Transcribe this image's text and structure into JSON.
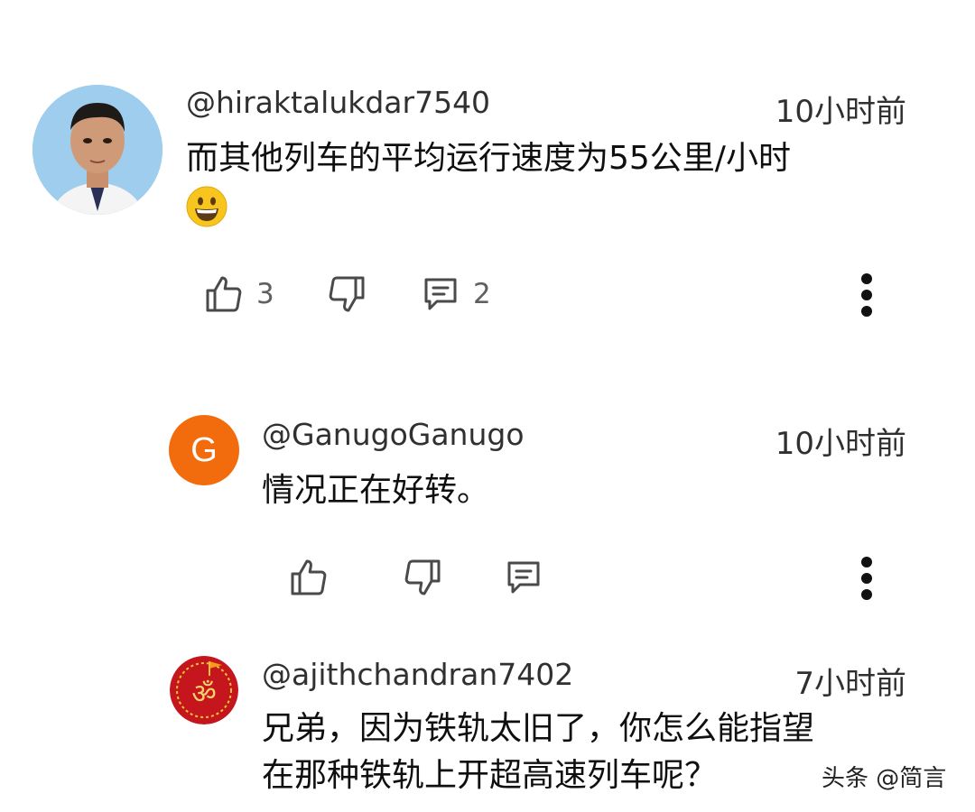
{
  "comments": [
    {
      "handle": "@hiraktalukdar7540",
      "time": "10小时前",
      "text": "而其他列车的平均运行速度为55公里/小时",
      "emoji": "grinning-face",
      "likes": "3",
      "replies": "2",
      "avatar": "photo"
    },
    {
      "handle": "@GanugoGanugo",
      "time": "10小时前",
      "text": "情况正在好转。",
      "avatar_letter": "G",
      "avatar_color": "#f26c0d"
    },
    {
      "handle": "@ajithchandran7402",
      "time": "7小时前",
      "text_line1": "兄弟，因为铁轨太旧了，你怎么能指望",
      "text_line2": "在那种铁轨上开超高速列车呢？",
      "avatar_symbol": "ॐ",
      "avatar_color": "#c4161c"
    }
  ],
  "watermark": "头条 @简言",
  "colors": {
    "icon": "#4a4a4a",
    "text": "#0f0f0f",
    "secondary": "#606060"
  }
}
